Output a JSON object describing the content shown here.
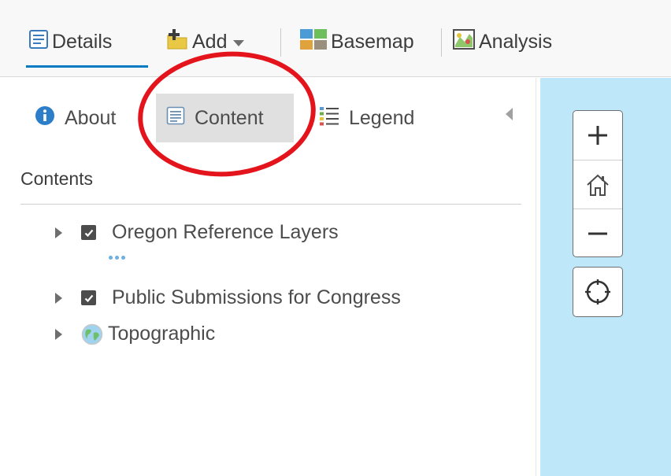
{
  "toolbar": {
    "details_label": "Details",
    "add_label": "Add",
    "basemap_label": "Basemap",
    "analysis_label": "Analysis",
    "active_tab": "Details",
    "accent_color": "#007ac2"
  },
  "panel": {
    "tabs": [
      {
        "label": "About",
        "icon": "info-icon"
      },
      {
        "label": "Content",
        "icon": "content-icon",
        "selected": true
      },
      {
        "label": "Legend",
        "icon": "legend-icon"
      }
    ],
    "contents_title": "Contents",
    "layers": [
      {
        "name": "Oregon Reference Layers",
        "checked": true,
        "icon": "checkbox"
      },
      {
        "name": "Public Submissions for Congress",
        "checked": true,
        "icon": "checkbox"
      },
      {
        "name": "Topographic",
        "icon": "globe-icon"
      }
    ]
  },
  "annotation": {
    "shape": "ellipse",
    "color": "#e4141c",
    "target": "Content"
  },
  "map": {
    "background_color": "#bee8fa",
    "controls": [
      "zoom-in",
      "home",
      "zoom-out",
      "locate"
    ]
  }
}
